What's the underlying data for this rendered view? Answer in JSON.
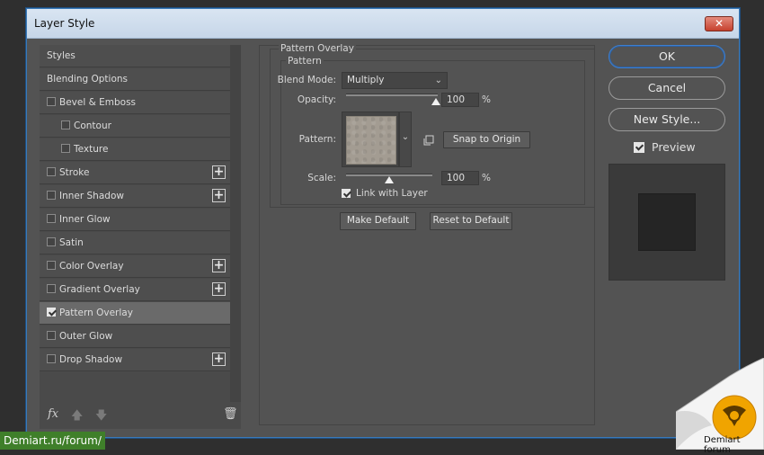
{
  "window": {
    "title": "Layer Style",
    "close_glyph": "✕"
  },
  "styles_list": {
    "items": [
      {
        "label": "Styles",
        "checkbox": false,
        "checked": false,
        "plus": false,
        "indent": 0,
        "selected": false
      },
      {
        "label": "Blending Options",
        "checkbox": false,
        "checked": false,
        "plus": false,
        "indent": 0,
        "selected": false
      },
      {
        "label": "Bevel & Emboss",
        "checkbox": true,
        "checked": false,
        "plus": false,
        "indent": 0,
        "selected": false
      },
      {
        "label": "Contour",
        "checkbox": true,
        "checked": false,
        "plus": false,
        "indent": 1,
        "selected": false
      },
      {
        "label": "Texture",
        "checkbox": true,
        "checked": false,
        "plus": false,
        "indent": 1,
        "selected": false
      },
      {
        "label": "Stroke",
        "checkbox": true,
        "checked": false,
        "plus": true,
        "indent": 0,
        "selected": false
      },
      {
        "label": "Inner Shadow",
        "checkbox": true,
        "checked": false,
        "plus": true,
        "indent": 0,
        "selected": false
      },
      {
        "label": "Inner Glow",
        "checkbox": true,
        "checked": false,
        "plus": false,
        "indent": 0,
        "selected": false
      },
      {
        "label": "Satin",
        "checkbox": true,
        "checked": false,
        "plus": false,
        "indent": 0,
        "selected": false
      },
      {
        "label": "Color Overlay",
        "checkbox": true,
        "checked": false,
        "plus": true,
        "indent": 0,
        "selected": false
      },
      {
        "label": "Gradient Overlay",
        "checkbox": true,
        "checked": false,
        "plus": true,
        "indent": 0,
        "selected": false
      },
      {
        "label": "Pattern Overlay",
        "checkbox": true,
        "checked": true,
        "plus": false,
        "indent": 0,
        "selected": true
      },
      {
        "label": "Outer Glow",
        "checkbox": true,
        "checked": false,
        "plus": false,
        "indent": 0,
        "selected": false
      },
      {
        "label": "Drop Shadow",
        "checkbox": true,
        "checked": false,
        "plus": true,
        "indent": 0,
        "selected": false
      }
    ],
    "plus_glyph": "+",
    "footer": {
      "fx_glyph": "fx",
      "up_glyph": "🡅",
      "down_glyph": "🡇",
      "trash_glyph": "🗑"
    }
  },
  "pattern_overlay": {
    "section_title": "Pattern Overlay",
    "group_title": "Pattern",
    "blend_mode_label": "Blend Mode:",
    "blend_mode_value": "Multiply",
    "opacity_label": "Opacity:",
    "opacity_value": "100",
    "opacity_unit": "%",
    "opacity_fraction": 1.0,
    "pattern_label": "Pattern:",
    "snap_button": "Snap to Origin",
    "scale_label": "Scale:",
    "scale_value": "100",
    "scale_unit": "%",
    "scale_fraction": 0.5,
    "link_label": "Link with Layer",
    "link_checked": true,
    "make_default": "Make Default",
    "reset_default": "Reset to Default",
    "chevron_glyph": "⌄"
  },
  "actions": {
    "ok": "OK",
    "cancel": "Cancel",
    "new_style": "New Style...",
    "preview_label": "Preview",
    "preview_checked": true
  },
  "watermark": {
    "url": "Demiart.ru/forum/",
    "label": "Demiart forum"
  },
  "colors": {
    "panel_bg": "#535353",
    "selected_row": "#6a6a6a",
    "ok_border": "#3d7fd0",
    "pattern_swatch": "#a39c92",
    "watermark_green": "#3f7f2a",
    "logo_orange": "#f0a400"
  }
}
